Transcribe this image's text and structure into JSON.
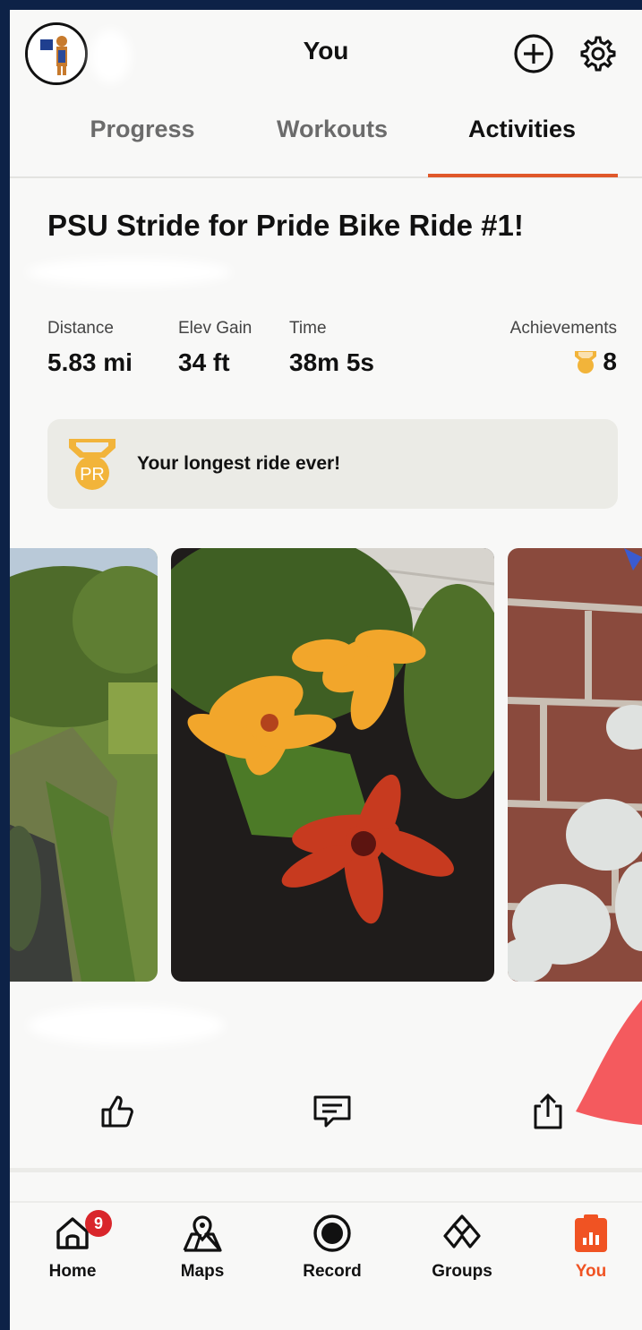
{
  "header": {
    "title": "You"
  },
  "tabs": [
    {
      "label": "Progress",
      "active": false
    },
    {
      "label": "Workouts",
      "active": false
    },
    {
      "label": "Activities",
      "active": true
    }
  ],
  "activity": {
    "title": "PSU Stride for Pride Bike Ride #1!",
    "stats": [
      {
        "label": "Distance",
        "value": "5.83 mi"
      },
      {
        "label": "Elev Gain",
        "value": "34 ft"
      },
      {
        "label": "Time",
        "value": "38m 5s"
      }
    ],
    "achievements": {
      "label": "Achievements",
      "value": "8"
    },
    "pr_message": "Your longest ride ever!",
    "pr_badge": "PR"
  },
  "nav": {
    "items": [
      {
        "label": "Home",
        "icon": "home-icon",
        "badge": "9"
      },
      {
        "label": "Maps",
        "icon": "maps-icon"
      },
      {
        "label": "Record",
        "icon": "record-icon"
      },
      {
        "label": "Groups",
        "icon": "groups-icon"
      },
      {
        "label": "You",
        "icon": "you-icon",
        "active": true
      }
    ]
  },
  "colors": {
    "accent": "#f05323",
    "medal": "#f2b43a",
    "frame": "#0d2247",
    "badge": "#d9262b"
  }
}
